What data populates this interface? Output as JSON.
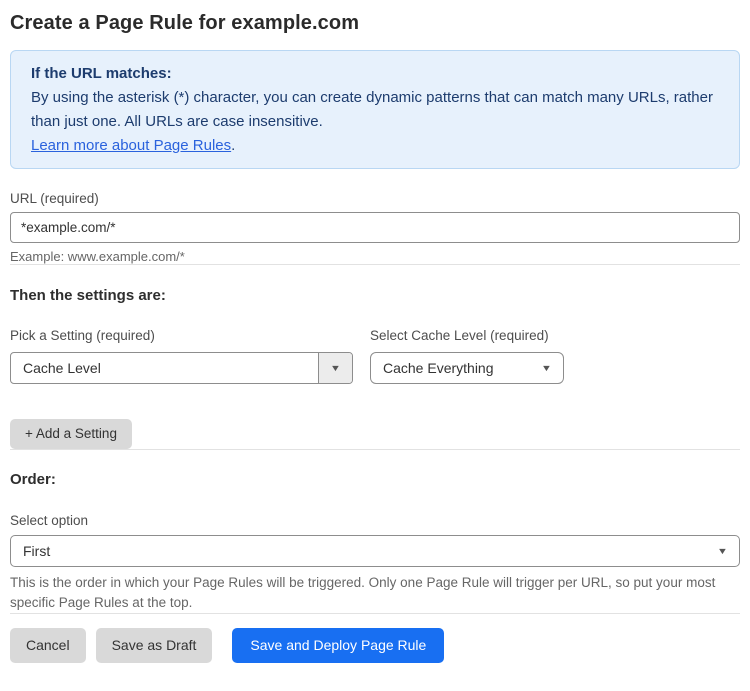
{
  "page": {
    "title": "Create a Page Rule for example.com"
  },
  "info_box": {
    "heading": "If the URL matches:",
    "body": "By using the asterisk (*) character, you can create dynamic patterns that can match many URLs, rather than just one. All URLs are case insensitive.",
    "link_label": "Learn more about Page Rules",
    "link_suffix": "."
  },
  "url_field": {
    "label": "URL (required)",
    "value": "*example.com/*",
    "helper": "Example: www.example.com/*"
  },
  "settings_section": {
    "heading": "Then the settings are:",
    "setting_picker": {
      "label": "Pick a Setting (required)",
      "value": "Cache Level"
    },
    "cache_level_picker": {
      "label": "Select Cache Level (required)",
      "value": "Cache Everything"
    },
    "add_setting_label": "+ Add a Setting"
  },
  "order_section": {
    "heading": "Order:",
    "select_label": "Select option",
    "value": "First",
    "helper": "This is the order in which your Page Rules will be triggered. Only one Page Rule will trigger per URL, so put your most specific Page Rules at the top."
  },
  "footer": {
    "cancel_label": "Cancel",
    "save_draft_label": "Save as Draft",
    "save_deploy_label": "Save and Deploy Page Rule"
  },
  "colors": {
    "accent_blue": "#186ff2",
    "info_background": "#e7f1fc",
    "info_border": "#b9d7f3",
    "info_text": "#1d3c6e",
    "link_blue": "#2a62dd"
  }
}
